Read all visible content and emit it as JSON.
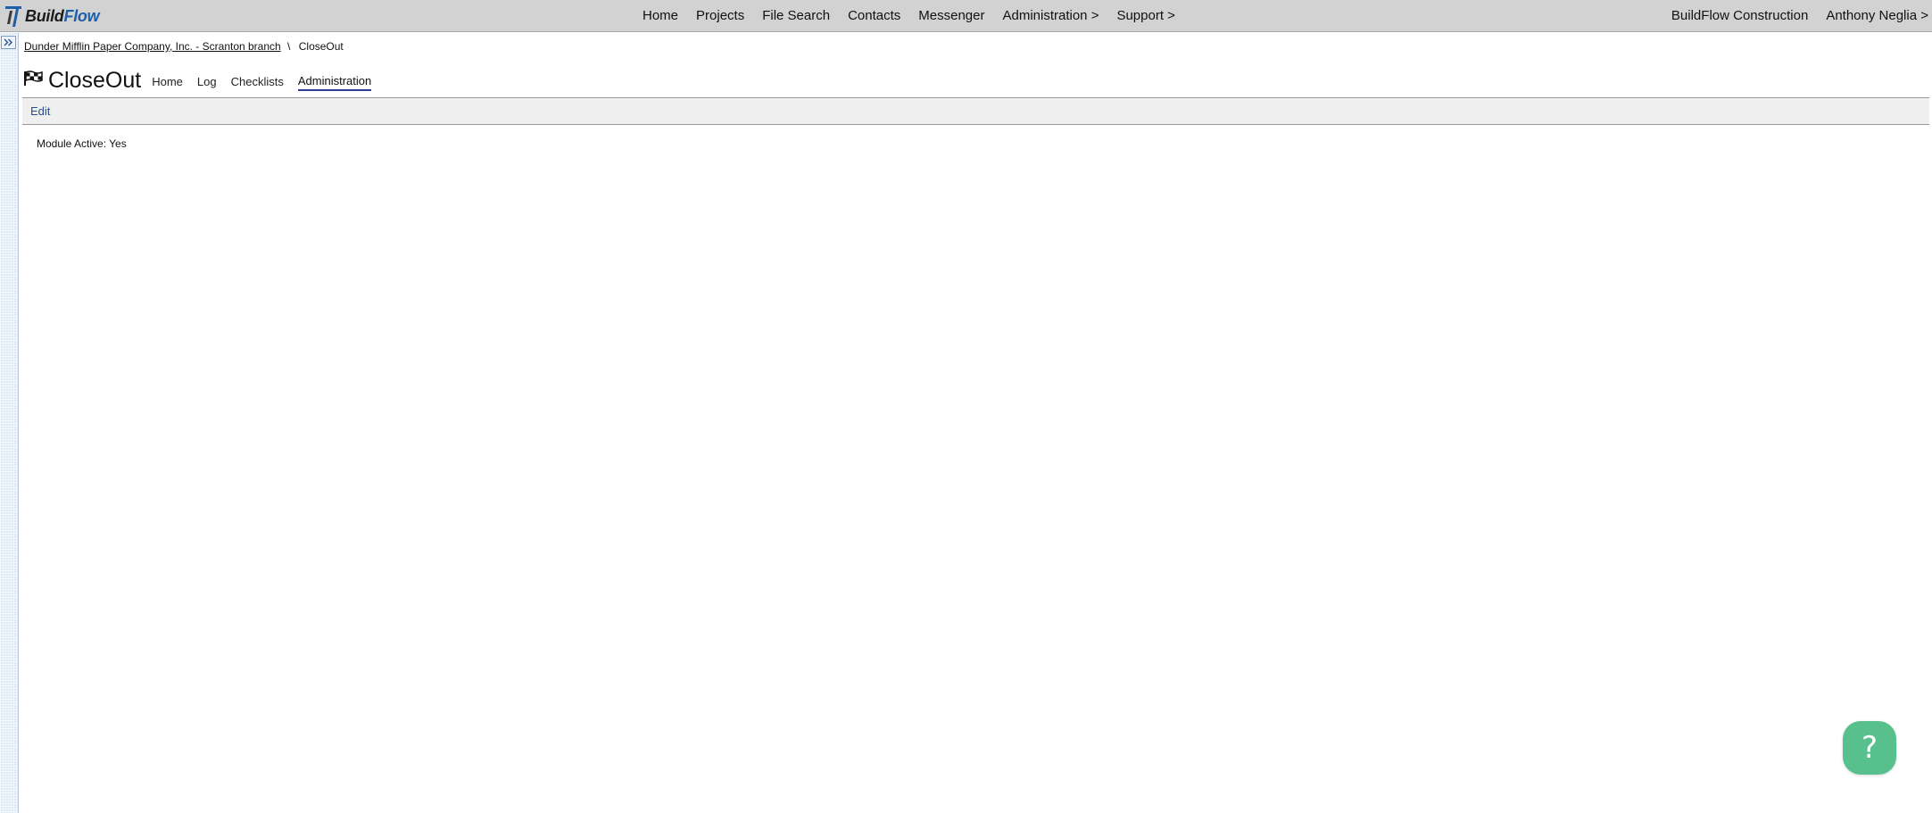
{
  "app": {
    "brand_part1": "Build",
    "brand_part2": "Flow"
  },
  "topnav": {
    "items": [
      "Home",
      "Projects",
      "File Search",
      "Contacts",
      "Messenger",
      "Administration >",
      "Support >"
    ],
    "company": "BuildFlow Construction",
    "user": "Anthony Neglia >"
  },
  "breadcrumb": {
    "parent": "Dunder Mifflin Paper Company, Inc. - Scranton branch",
    "separator": "\\",
    "current": "CloseOut"
  },
  "module": {
    "icon": "checkered-flag-icon",
    "title": "CloseOut",
    "tabs": [
      "Home",
      "Log",
      "Checklists",
      "Administration"
    ],
    "active_tab": "Administration"
  },
  "toolbar": {
    "edit_label": "Edit"
  },
  "fields": {
    "module_active": "Module Active: Yes"
  },
  "help": {
    "label": "?"
  },
  "colors": {
    "topbar": "#d2d2d2",
    "brand_blue": "#1f5fa8",
    "active_tab_underline": "#2a3d8f",
    "help_green": "#57c08c"
  }
}
